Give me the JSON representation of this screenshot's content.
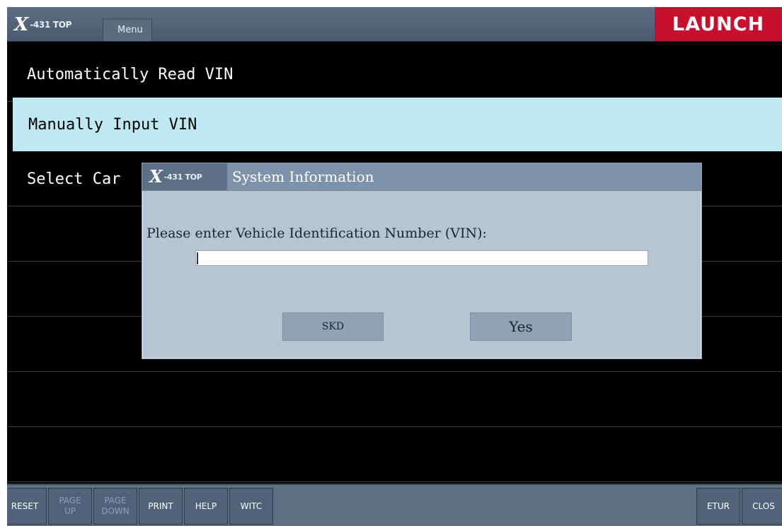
{
  "header": {
    "logo_mark": "X",
    "logo_text": "-431 TOP",
    "menu_tab": "Menu",
    "brand": "LAUNCH"
  },
  "menu": {
    "items": [
      {
        "label": "Automatically Read VIN",
        "selected": false
      },
      {
        "label": "Manually Input VIN",
        "selected": true
      },
      {
        "label": "Select Car",
        "selected": false
      }
    ]
  },
  "dialog": {
    "logo_mark": "X",
    "logo_text": "-431 TOP",
    "title": "System Information",
    "prompt": "Please enter Vehicle Identification Number (VIN):",
    "vin_value": "",
    "buttons": {
      "skd": "SKD",
      "yes": "Yes"
    }
  },
  "toolbar": {
    "buttons": [
      {
        "label": "RESET",
        "enabled": true
      },
      {
        "label": "PAGE\nUP",
        "enabled": false
      },
      {
        "label": "PAGE\nDOWN",
        "enabled": false
      },
      {
        "label": "PRINT",
        "enabled": true
      },
      {
        "label": "HELP",
        "enabled": true
      },
      {
        "label": "WITC",
        "enabled": true
      },
      {
        "label": "ETUR",
        "enabled": true
      },
      {
        "label": "CLOS",
        "enabled": true
      }
    ]
  },
  "colors": {
    "brand_red": "#c8102e",
    "selected_row": "#bfe9f2",
    "dialog_bg": "#b7c4d2",
    "toolbar_bg": "#5f6f83"
  }
}
